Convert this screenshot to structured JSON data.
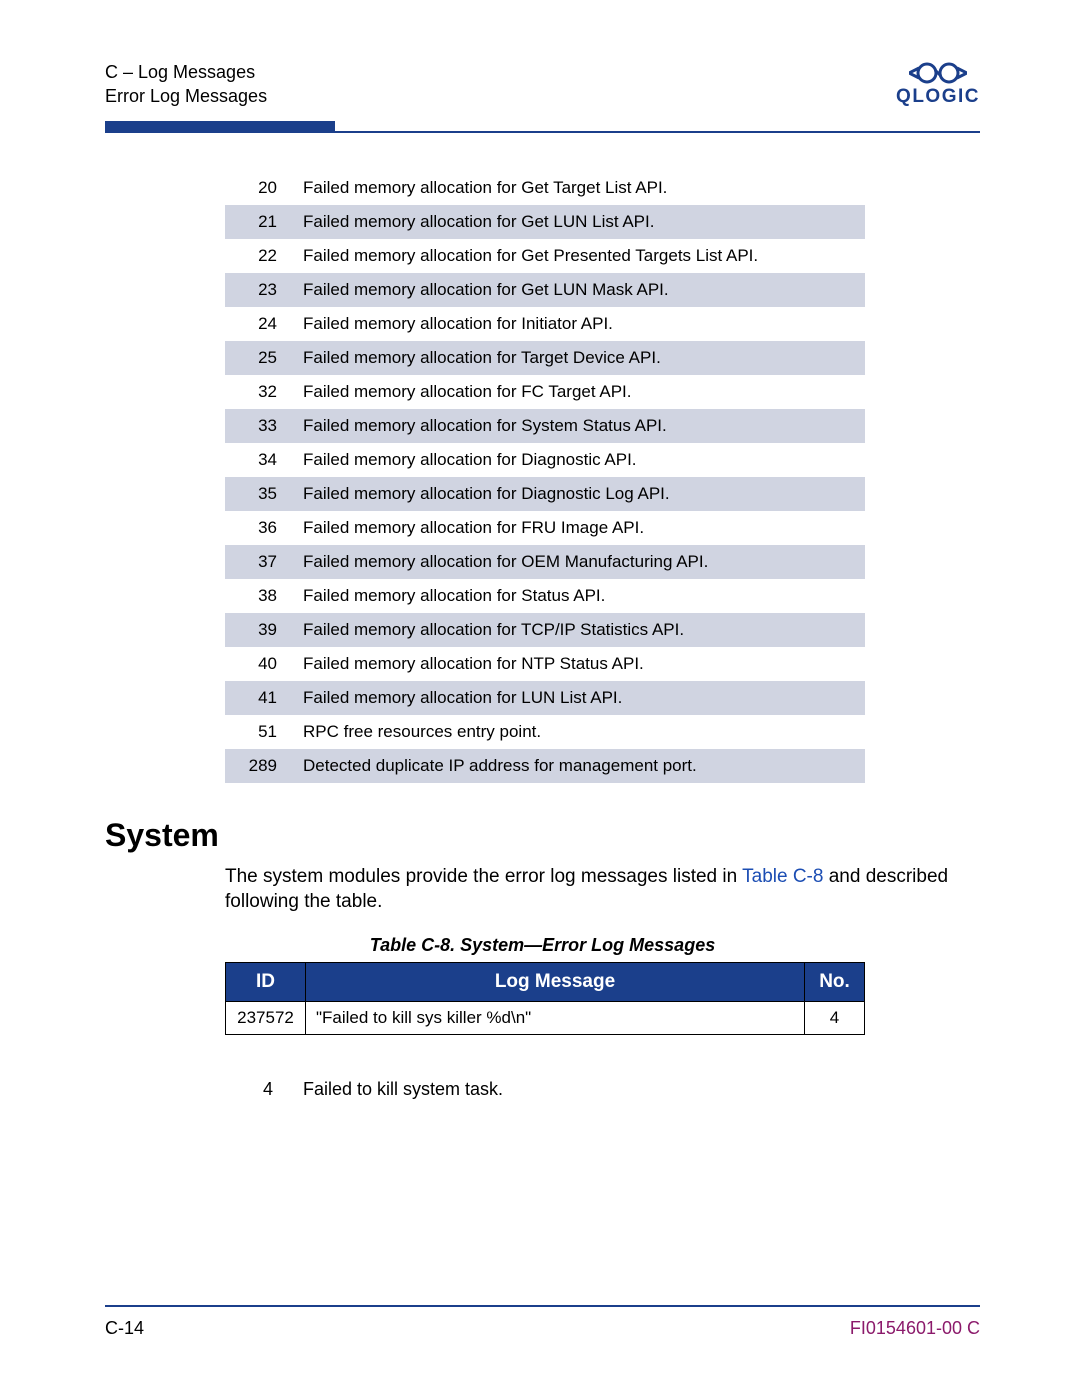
{
  "header": {
    "line1": "C – Log Messages",
    "line2": "Error Log Messages",
    "logo_text": "QLOGIC"
  },
  "table1_rows": [
    {
      "id": "20",
      "msg": "Failed memory allocation for Get Target List API."
    },
    {
      "id": "21",
      "msg": "Failed memory allocation for Get LUN List API."
    },
    {
      "id": "22",
      "msg": "Failed memory allocation for Get Presented Targets List API."
    },
    {
      "id": "23",
      "msg": "Failed memory allocation for Get LUN Mask API."
    },
    {
      "id": "24",
      "msg": "Failed memory allocation for Initiator API."
    },
    {
      "id": "25",
      "msg": "Failed memory allocation for Target Device API."
    },
    {
      "id": "32",
      "msg": "Failed memory allocation for FC Target API."
    },
    {
      "id": "33",
      "msg": "Failed memory allocation for System Status API."
    },
    {
      "id": "34",
      "msg": "Failed memory allocation for Diagnostic API."
    },
    {
      "id": "35",
      "msg": "Failed memory allocation for Diagnostic Log API."
    },
    {
      "id": "36",
      "msg": "Failed memory allocation for FRU Image API."
    },
    {
      "id": "37",
      "msg": "Failed memory allocation for OEM Manufacturing API."
    },
    {
      "id": "38",
      "msg": "Failed memory allocation for Status API."
    },
    {
      "id": "39",
      "msg": "Failed memory allocation for TCP/IP Statistics API."
    },
    {
      "id": "40",
      "msg": "Failed memory allocation for NTP Status API."
    },
    {
      "id": "41",
      "msg": "Failed memory allocation for LUN List API."
    },
    {
      "id": "51",
      "msg": "RPC free resources entry point."
    },
    {
      "id": "289",
      "msg": "Detected duplicate IP address for management port."
    }
  ],
  "section_heading": "System",
  "body_text_pre": "The system modules provide the error log messages listed in ",
  "body_text_xref": "Table C-8",
  "body_text_post": " and described following the table.",
  "table2": {
    "caption": "Table C-8. System—Error Log Messages",
    "headers": {
      "id": "ID",
      "msg": "Log Message",
      "no": "No."
    },
    "rows": [
      {
        "id": "237572",
        "msg": "\"Failed to kill sys killer %d\\n\"",
        "no": "4"
      }
    ]
  },
  "table3_rows": [
    {
      "id": "4",
      "msg": "Failed to kill system task."
    }
  ],
  "footer": {
    "page": "C-14",
    "docnum": "FI0154601-00  C"
  }
}
